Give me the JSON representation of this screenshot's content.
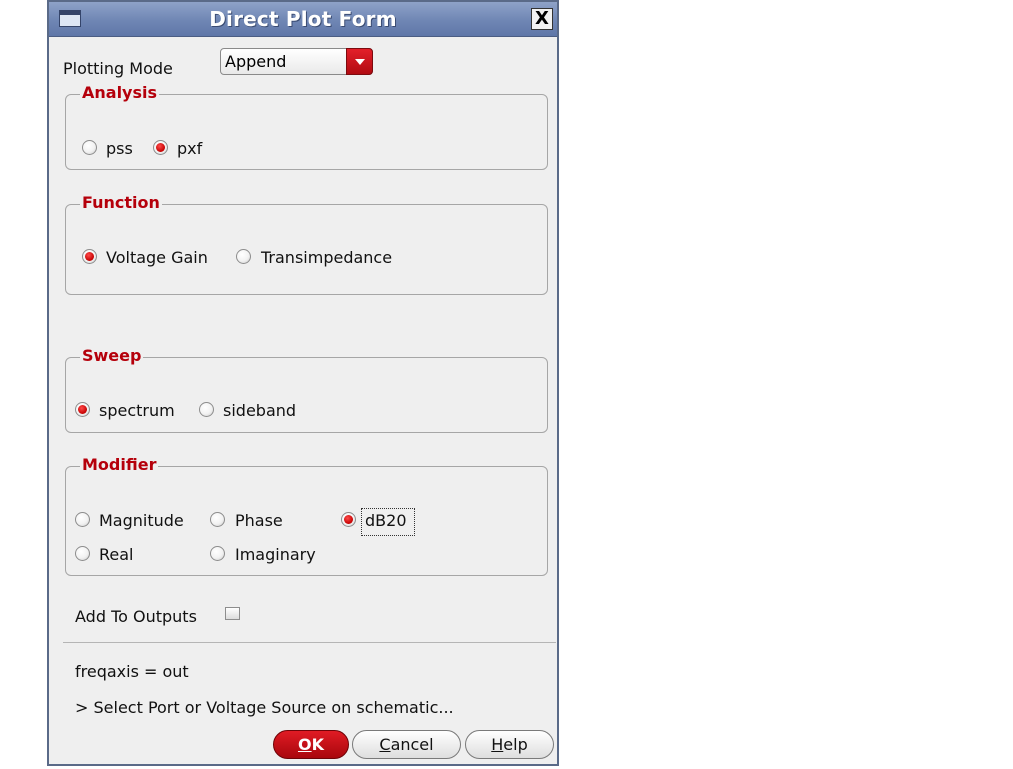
{
  "window": {
    "title": "Direct Plot Form",
    "close_glyph": "X"
  },
  "plotting_mode": {
    "label": "Plotting Mode",
    "value": "Append"
  },
  "analysis": {
    "title": "Analysis",
    "options": [
      {
        "label": "pss",
        "selected": false
      },
      {
        "label": "pxf",
        "selected": true
      }
    ]
  },
  "function": {
    "title": "Function",
    "options": [
      {
        "label": "Voltage Gain",
        "selected": true
      },
      {
        "label": "Transimpedance",
        "selected": false
      }
    ]
  },
  "sweep": {
    "title": "Sweep",
    "options": [
      {
        "label": "spectrum",
        "selected": true
      },
      {
        "label": "sideband",
        "selected": false
      }
    ]
  },
  "modifier": {
    "title": "Modifier",
    "options": [
      {
        "label": "Magnitude",
        "selected": false
      },
      {
        "label": "Phase",
        "selected": false
      },
      {
        "label": "dB20",
        "selected": true
      },
      {
        "label": "Real",
        "selected": false
      },
      {
        "label": "Imaginary",
        "selected": false
      }
    ]
  },
  "add_to_outputs": {
    "label": "Add To Outputs",
    "checked": false
  },
  "status": {
    "freqaxis": "freqaxis = out",
    "prompt": "> Select Port or Voltage Source on schematic..."
  },
  "buttons": {
    "ok": {
      "mnemonic": "O",
      "rest": "K"
    },
    "cancel": {
      "mnemonic": "C",
      "rest": "ancel"
    },
    "help": {
      "mnemonic": "H",
      "rest": "elp"
    }
  },
  "colors": {
    "accent_red": "#b5000b",
    "titlebar_blue": "#6f86b4",
    "dialog_bg": "#efefef"
  }
}
